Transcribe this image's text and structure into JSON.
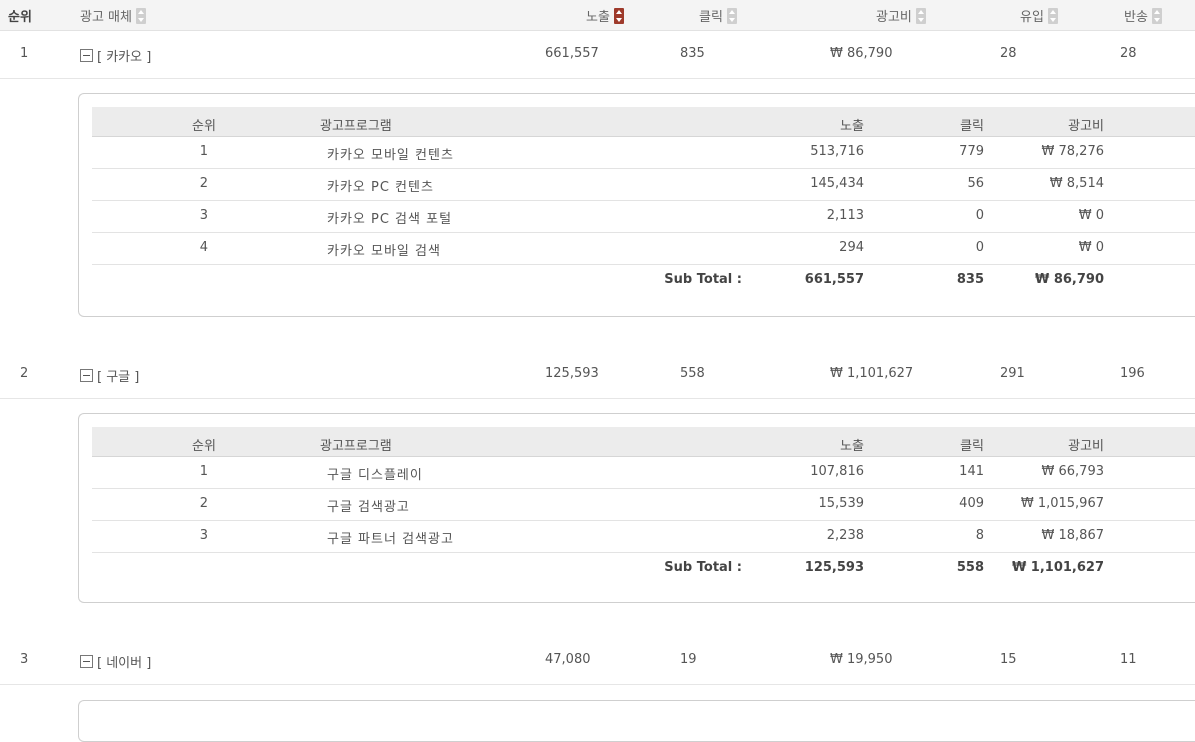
{
  "header": {
    "rank": "순위",
    "media": "광고 매체",
    "impressions": "노출",
    "clicks": "클릭",
    "cost": "광고비",
    "inflow": "유입",
    "bounce": "반송"
  },
  "detail_header": {
    "rank": "순위",
    "program": "광고프로그램",
    "impressions": "노출",
    "clicks": "클릭",
    "cost": "광고비"
  },
  "subtotal_label": "Sub Total :",
  "groups": [
    {
      "rank": "1",
      "name": "[ 카카오 ]",
      "impressions": "661,557",
      "clicks": "835",
      "cost": "₩ 86,790",
      "inflow": "28",
      "bounce": "28",
      "items": [
        {
          "rank": "1",
          "program": "카카오 모바일 컨텐츠",
          "impressions": "513,716",
          "clicks": "779",
          "cost": "₩ 78,276"
        },
        {
          "rank": "2",
          "program": "카카오 PC 컨텐츠",
          "impressions": "145,434",
          "clicks": "56",
          "cost": "₩ 8,514"
        },
        {
          "rank": "3",
          "program": "카카오 PC 검색 포털",
          "impressions": "2,113",
          "clicks": "0",
          "cost": "₩ 0"
        },
        {
          "rank": "4",
          "program": "카카오 모바일 검색",
          "impressions": "294",
          "clicks": "0",
          "cost": "₩ 0"
        }
      ],
      "subtotal": {
        "impressions": "661,557",
        "clicks": "835",
        "cost": "₩ 86,790"
      }
    },
    {
      "rank": "2",
      "name": "[ 구글 ]",
      "impressions": "125,593",
      "clicks": "558",
      "cost": "₩ 1,101,627",
      "inflow": "291",
      "bounce": "196",
      "items": [
        {
          "rank": "1",
          "program": "구글 디스플레이",
          "impressions": "107,816",
          "clicks": "141",
          "cost": "₩ 66,793"
        },
        {
          "rank": "2",
          "program": "구글 검색광고",
          "impressions": "15,539",
          "clicks": "409",
          "cost": "₩ 1,015,967"
        },
        {
          "rank": "3",
          "program": "구글 파트너 검색광고",
          "impressions": "2,238",
          "clicks": "8",
          "cost": "₩ 18,867"
        }
      ],
      "subtotal": {
        "impressions": "125,593",
        "clicks": "558",
        "cost": "₩ 1,101,627"
      }
    },
    {
      "rank": "3",
      "name": "[ 네이버 ]",
      "impressions": "47,080",
      "clicks": "19",
      "cost": "₩ 19,950",
      "inflow": "15",
      "bounce": "11",
      "items": [],
      "subtotal": null
    }
  ],
  "colors": {
    "sort_active": "#9e3a2b",
    "sort_inactive": "#cfcfcf",
    "header_bg": "#f4f4f4"
  },
  "icons": {
    "sort": "sort-arrows-icon",
    "collapse": "collapse-minus-icon"
  }
}
